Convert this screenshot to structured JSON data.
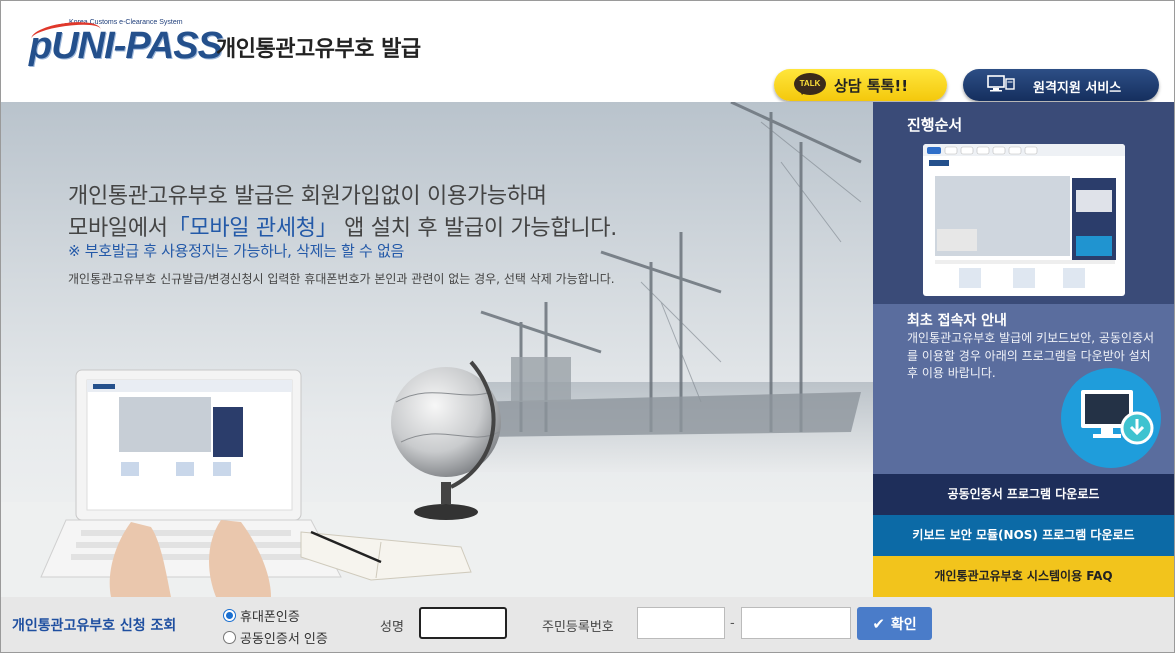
{
  "header": {
    "logo_subtitle": "Korea Customs e-Clearance System",
    "logo_text": "UNI-PASS",
    "title": "개인통관고유부호 발급",
    "talk_badge": "TALK",
    "talk_button": "상담 톡톡!!",
    "remote_button": "원격지원 서비스"
  },
  "hero": {
    "line1": "개인통관고유부호 발급은 회원가입없이 이용가능하며",
    "line2_prefix": "모바일에서",
    "line2_highlight": "「모바일 관세청」",
    "line2_suffix": "앱 설치 후 발급이 가능합니다.",
    "notice": "※ 부호발급 후 사용정지는 가능하나, 삭제는 할 수 없음",
    "desc": "개인통관고유부호 신규발급/변경신청시 입력한 휴대폰번호가 본인과 관련이 없는 경우, 선택 삭제 가능합니다."
  },
  "sidebar": {
    "process_title": "진행순서",
    "first_title": "최초 접속자 안내",
    "first_text": "개인통관고유부호 발급에 키보드보안, 공동인증서를 이용할 경우 아래의 프로그램을 다운받아 설치 후 이용 바랍니다.",
    "btn_cert": "공동인증서 프로그램 다운로드",
    "btn_nos": "키보드 보안 모듈(NOS) 프로그램 다운로드",
    "btn_faq": "개인통관고유부호 시스템이용 FAQ"
  },
  "search": {
    "title": "개인통관고유부호 신청 조회",
    "option_phone": "휴대폰인증",
    "option_cert": "공동인증서 인증",
    "selected_option": "휴대폰인증",
    "name_label": "성명",
    "name_value": "",
    "rrn_label": "주민등록번호",
    "rrn_front_value": "",
    "rrn_back_value": "",
    "dash": "-",
    "confirm_button": "확인"
  },
  "colors": {
    "brand_blue": "#24508c",
    "sidebar_dark": "#3a4b78",
    "sidebar_mid": "#5a6d9e",
    "cert_button": "#1e2e5a",
    "nos_button": "#0c6aa6",
    "faq_button": "#f2c41c",
    "talk_yellow": "#f4c80c",
    "confirm_button": "#4a7cc9"
  }
}
